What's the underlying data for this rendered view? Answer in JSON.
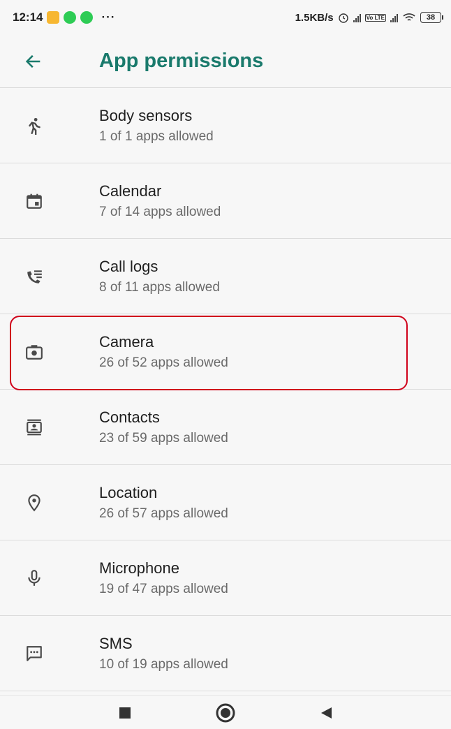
{
  "status_bar": {
    "time": "12:14",
    "dots": "···",
    "net_speed": "1.5KB/s",
    "volte": "Vo LTE",
    "battery": "38"
  },
  "app_bar": {
    "title": "App permissions"
  },
  "permissions": [
    {
      "icon": "body-sensors-icon",
      "label": "Body sensors",
      "status": "1 of 1 apps allowed"
    },
    {
      "icon": "calendar-icon",
      "label": "Calendar",
      "status": "7 of 14 apps allowed"
    },
    {
      "icon": "call-logs-icon",
      "label": "Call logs",
      "status": "8 of 11 apps allowed"
    },
    {
      "icon": "camera-icon",
      "label": "Camera",
      "status": "26 of 52 apps allowed"
    },
    {
      "icon": "contacts-icon",
      "label": "Contacts",
      "status": "23 of 59 apps allowed"
    },
    {
      "icon": "location-icon",
      "label": "Location",
      "status": "26 of 57 apps allowed"
    },
    {
      "icon": "microphone-icon",
      "label": "Microphone",
      "status": "19 of 47 apps allowed"
    },
    {
      "icon": "sms-icon",
      "label": "SMS",
      "status": "10 of 19 apps allowed"
    }
  ],
  "highlighted_item": "Camera",
  "colors": {
    "accent": "#1a7a6c",
    "icon": "#4a4a4a",
    "highlight": "#d0021b"
  }
}
